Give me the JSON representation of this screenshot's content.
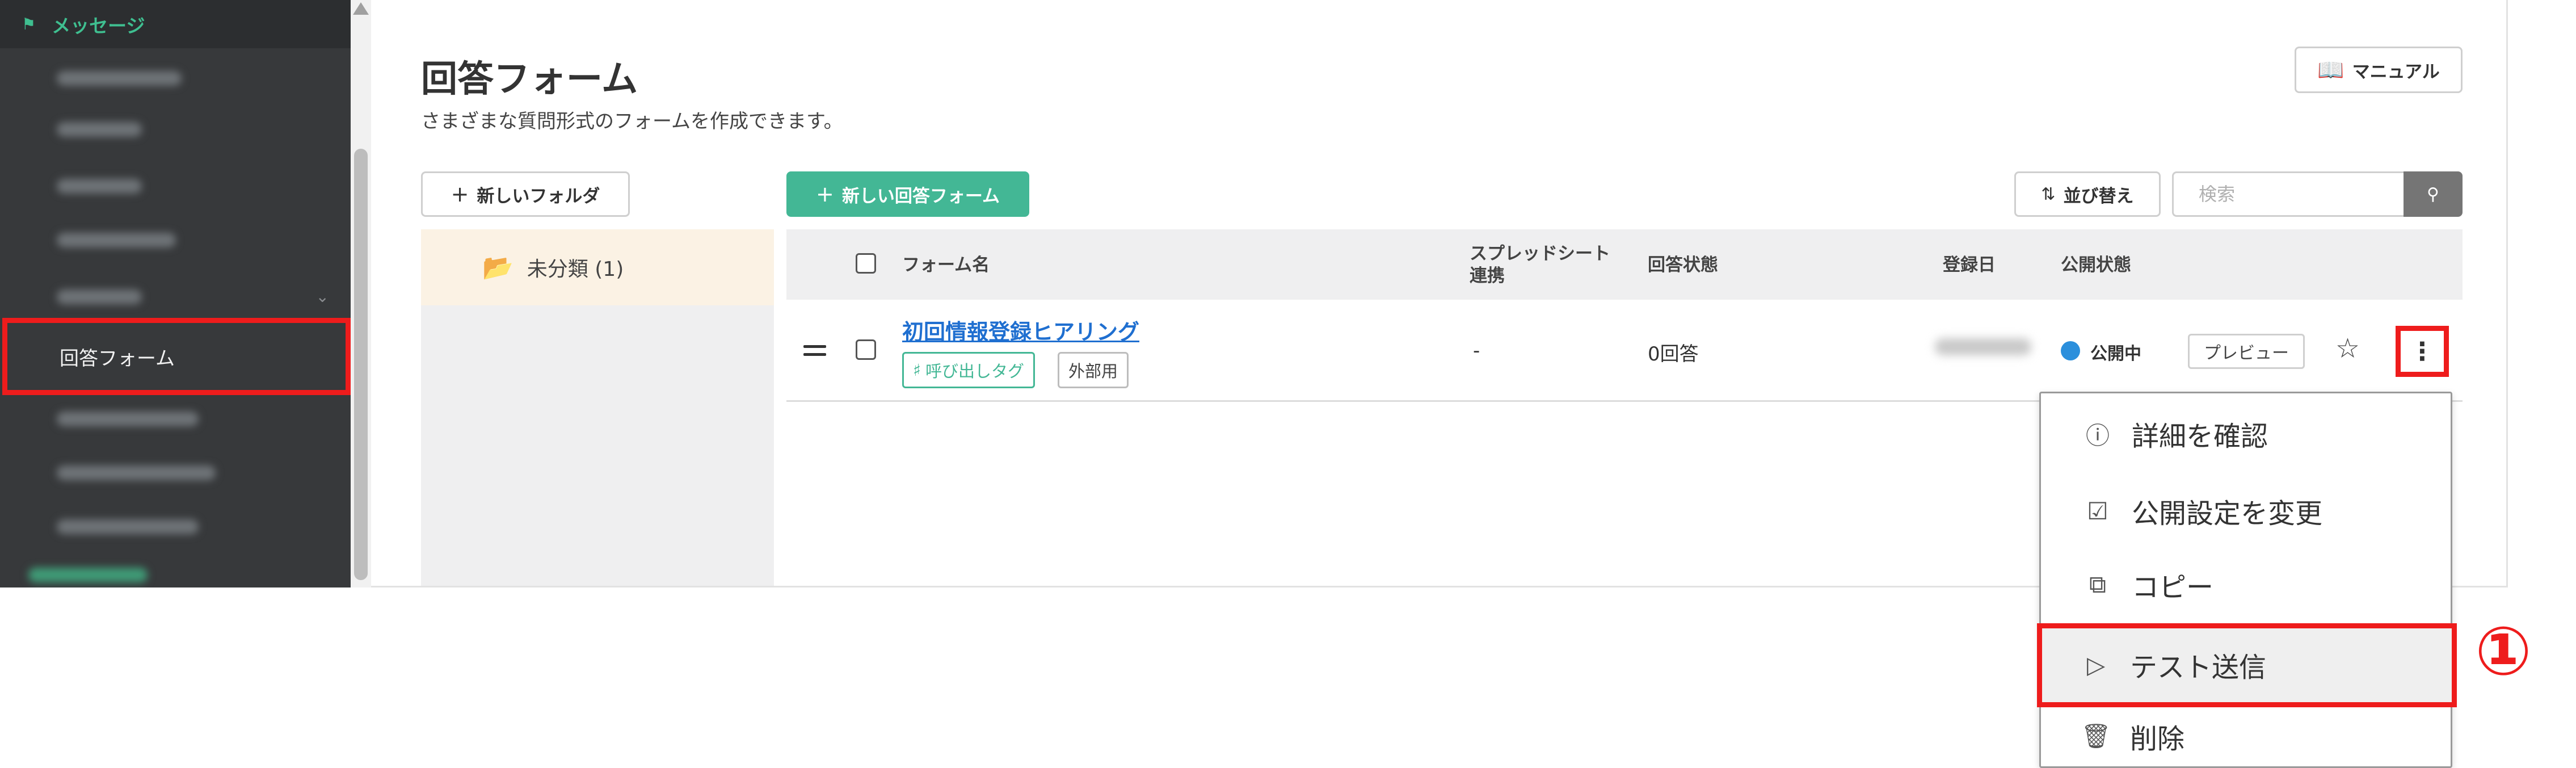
{
  "sidebar": {
    "header": {
      "icon": "megaphone-icon",
      "label": "メッセージ"
    },
    "active_item": {
      "label": "回答フォーム"
    }
  },
  "page": {
    "title": "回答フォーム",
    "subtitle": "さまざまな質問形式のフォームを作成できます。"
  },
  "toolbar": {
    "manual_icon": "book-icon",
    "manual_label": "マニュアル",
    "new_folder_label": "新しいフォルダ",
    "new_form_label": "新しい回答フォーム",
    "sort_label": "並び替え",
    "search_placeholder": "検索",
    "search_icon": "search-icon"
  },
  "folders": [
    {
      "icon": "folder-open-icon",
      "label": "未分類 (1)"
    }
  ],
  "table": {
    "headers": {
      "form_name": "フォーム名",
      "spreadsheet": "スプレッドシート連携",
      "answer_status": "回答状態",
      "registered": "登録日",
      "publish_status": "公開状態"
    },
    "rows": [
      {
        "name": "初回情報登録ヒアリング",
        "tags": [
          "呼び出しタグ",
          "外部用"
        ],
        "spreadsheet": "-",
        "answers": "0回答",
        "status": "公開中",
        "status_color": "#2b8fdc",
        "preview_label": "プレビュー"
      }
    ]
  },
  "menu": {
    "items": [
      {
        "icon": "info-icon",
        "label": "詳細を確認"
      },
      {
        "icon": "document-check-icon",
        "label": "公開設定を変更"
      },
      {
        "icon": "copy-icon",
        "label": "コピー"
      },
      {
        "icon": "send-icon",
        "label": "テスト送信"
      },
      {
        "icon": "trash-icon",
        "label": "削除"
      }
    ]
  },
  "annotation": {
    "marker": "①",
    "color": "#ee1c1c"
  },
  "colors": {
    "accent": "#43b795",
    "link": "#1f6fd0",
    "highlight": "#ee1c1c",
    "sidebar_bg": "#37393b"
  }
}
